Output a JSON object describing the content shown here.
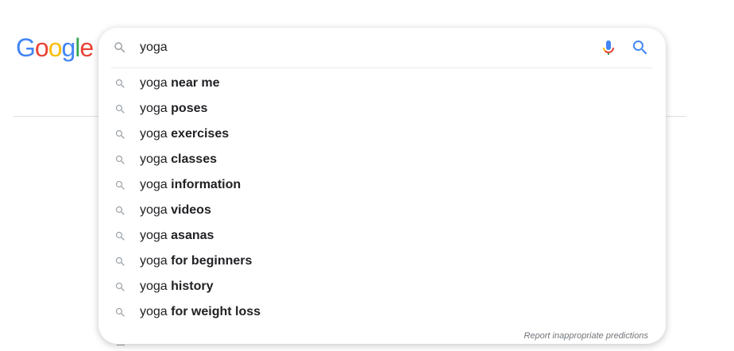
{
  "logo": {
    "letters": [
      "G",
      "o",
      "o",
      "g",
      "l",
      "e"
    ],
    "colors": [
      "#4285f4",
      "#ea4335",
      "#fbbc05",
      "#4285f4",
      "#34a853",
      "#ea4335"
    ]
  },
  "search": {
    "query": "yoga",
    "icon": "search-icon",
    "voice_icon": "microphone-icon",
    "submit_icon": "search-icon"
  },
  "suggestions": [
    {
      "prefix": "yoga",
      "completion": "near me"
    },
    {
      "prefix": "yoga",
      "completion": "poses"
    },
    {
      "prefix": "yoga",
      "completion": "exercises"
    },
    {
      "prefix": "yoga",
      "completion": "classes"
    },
    {
      "prefix": "yoga",
      "completion": "information"
    },
    {
      "prefix": "yoga",
      "completion": "videos"
    },
    {
      "prefix": "yoga",
      "completion": "asanas"
    },
    {
      "prefix": "yoga",
      "completion": "for beginners"
    },
    {
      "prefix": "yoga",
      "completion": "history"
    },
    {
      "prefix": "yoga",
      "completion": "for weight loss"
    }
  ],
  "report_link": "Report inappropriate predictions",
  "colors": {
    "accent_blue": "#4285f4",
    "text": "#202124",
    "icon_gray": "#9aa0a6"
  }
}
